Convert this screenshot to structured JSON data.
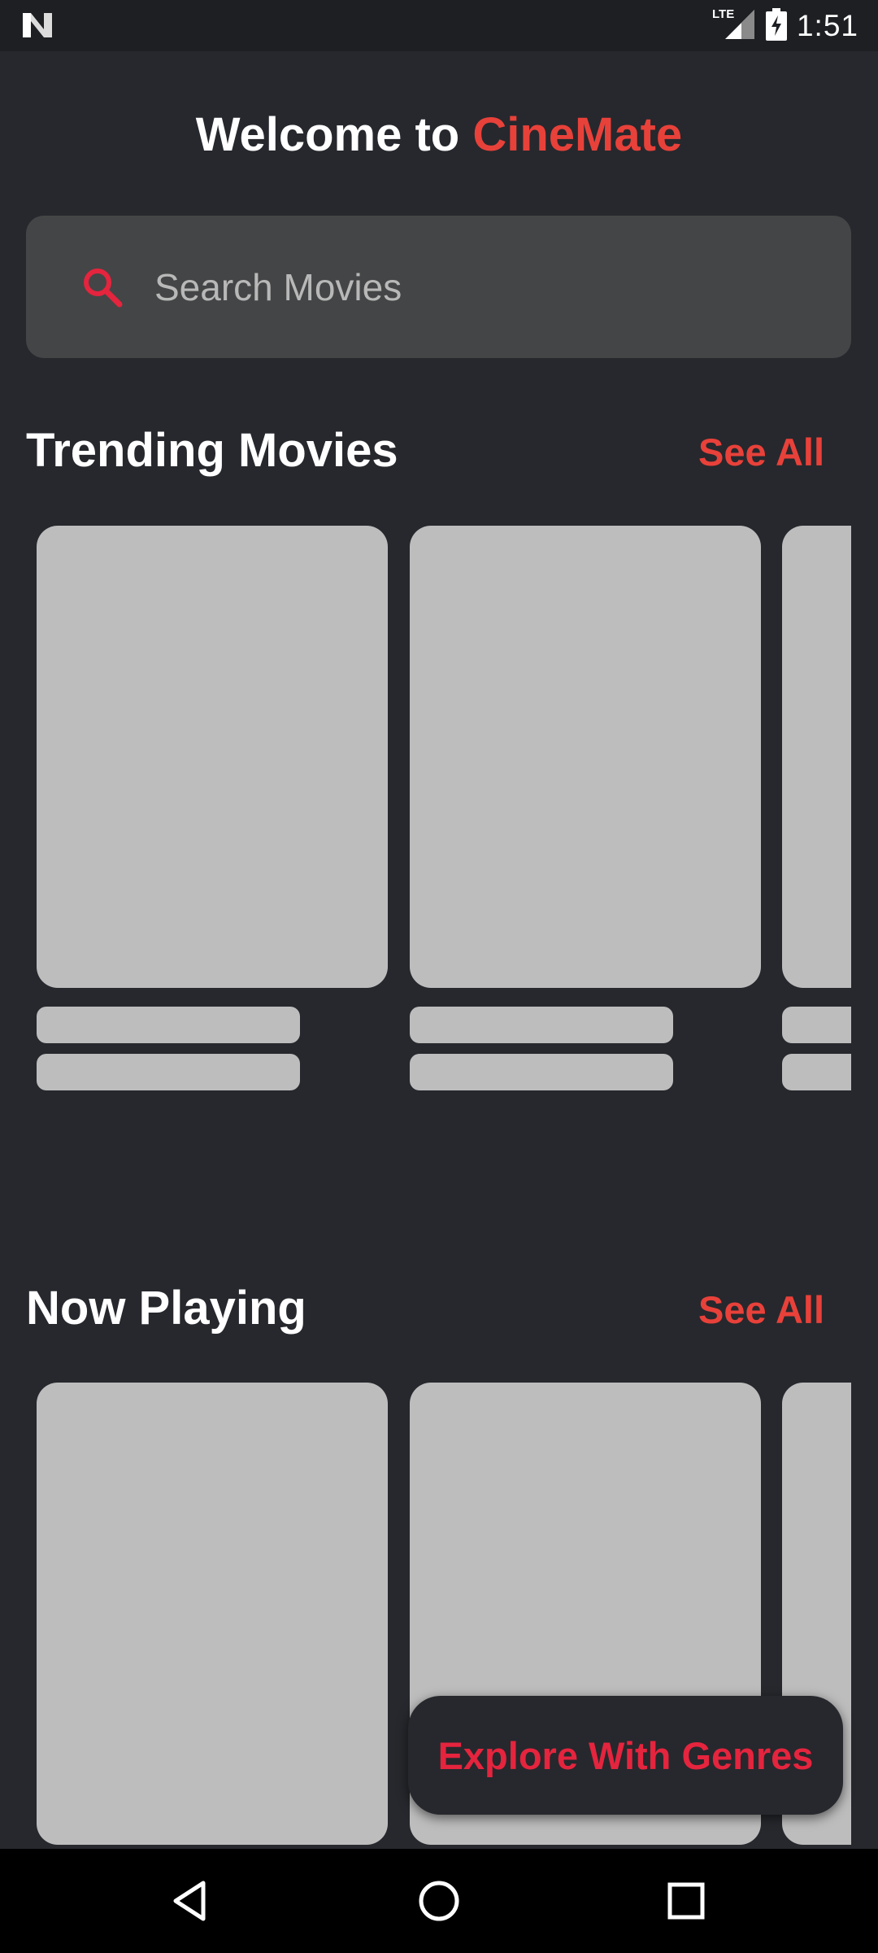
{
  "status_bar": {
    "time": "1:51",
    "network_label": "LTE",
    "icons": [
      "n-logo-icon",
      "lte-icon",
      "signal-icon",
      "battery-charging-icon"
    ]
  },
  "header": {
    "welcome_prefix": "Welcome to ",
    "brand_name": "CineMate"
  },
  "search": {
    "placeholder": "Search Movies",
    "value": "",
    "icon": "search-icon"
  },
  "sections": {
    "trending": {
      "title": "Trending Movies",
      "see_all": "See All"
    },
    "now_playing": {
      "title": "Now Playing",
      "see_all": "See All"
    }
  },
  "fab": {
    "label": "Explore With Genres"
  },
  "nav_bar": {
    "icons": [
      "back-icon",
      "home-icon",
      "recents-icon"
    ]
  },
  "colors": {
    "background": "#26282d",
    "accent": "#e8413a",
    "fab_text": "#e5243e",
    "skeleton": "#bdbdbd",
    "search_bg": "#444546"
  }
}
